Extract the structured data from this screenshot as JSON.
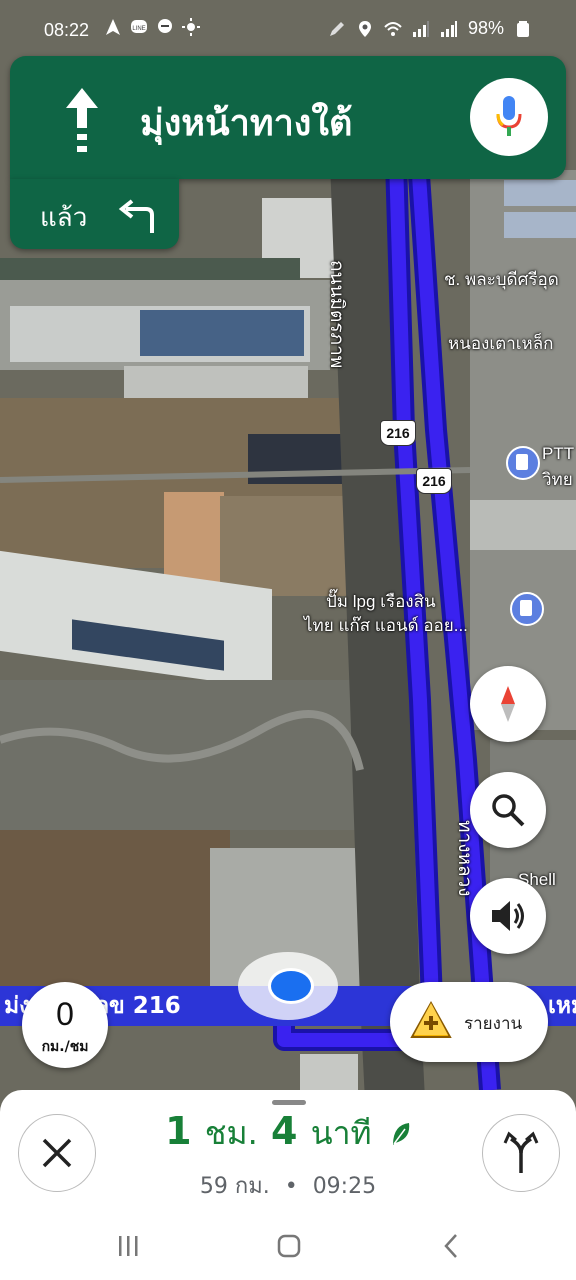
{
  "status": {
    "time": "08:22",
    "battery": "98%",
    "left_icons": [
      "navigation-arrow-icon",
      "line-app-icon",
      "chat-bubble-icon",
      "sun-icon"
    ],
    "right_icons": [
      "pencil-icon",
      "location-pin-icon",
      "wifi-icon",
      "signal-icon",
      "signal-icon-2",
      "battery-icon"
    ]
  },
  "direction": {
    "instruction": "มุ่งหน้าทางใต้",
    "then_label": "แล้ว",
    "arrow_icon": "arrow-up-icon",
    "then_icon": "turn-left-icon"
  },
  "map": {
    "labels": [
      "ช. พละบุดีศรีอุด",
      "หนองเตาเหล็ก",
      "PTT",
      "วิทย",
      "ปั๊ม lpg เรืองสิน",
      "ไทย แก๊ส แอนด์ ออย...",
      "Shell",
      "ถนนมิตรภาพ",
      "ทางหลวง"
    ],
    "route_shield": "216",
    "route_color": "#3a22f0"
  },
  "road": {
    "name": "ม่งหมายเลข 216",
    "next": "เหม"
  },
  "speed": {
    "value": "0",
    "unit": "กม./ชม"
  },
  "report": {
    "label": "รายงาน"
  },
  "trip": {
    "eta_hours": "1",
    "eta_hours_unit": "ชม.",
    "eta_minutes": "4",
    "eta_minutes_unit": "นาที",
    "distance": "59 กม.",
    "separator": "•",
    "arrival": "09:25"
  },
  "colors": {
    "banner": "#0f6545",
    "eta": "#188038"
  }
}
